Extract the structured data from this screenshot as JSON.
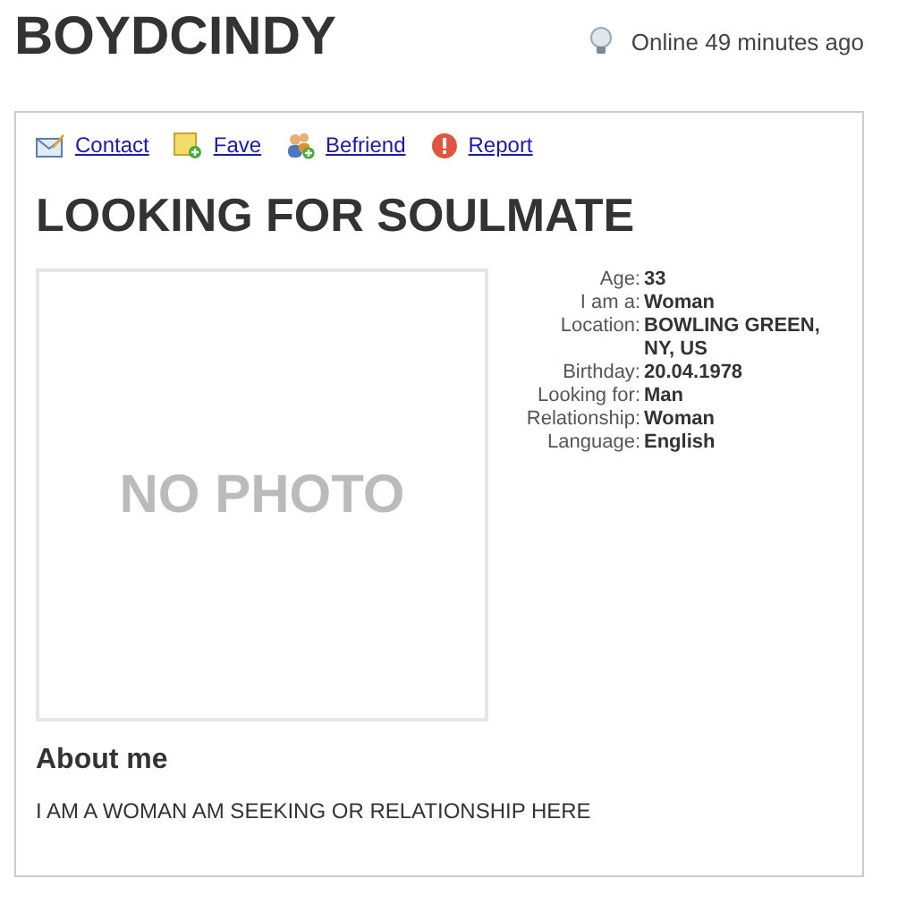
{
  "username": "BOYDCINDY",
  "status": "Online 49 minutes ago",
  "actions": [
    {
      "kind": "contact",
      "label": "Contact"
    },
    {
      "kind": "fave",
      "label": "Fave"
    },
    {
      "kind": "befriend",
      "label": "Befriend"
    },
    {
      "kind": "report",
      "label": "Report"
    }
  ],
  "headline": "LOOKING FOR SOULMATE",
  "photo_placeholder": "NO PHOTO",
  "details": [
    {
      "label": "Age:",
      "value": "33"
    },
    {
      "label": "I am a:",
      "value": "Woman"
    },
    {
      "label": "Location:",
      "value": "BOWLING GREEN, NY, US"
    },
    {
      "label": "Birthday:",
      "value": "20.04.1978"
    },
    {
      "label": "Looking for:",
      "value": "Man"
    },
    {
      "label": "Relationship:",
      "value": "Woman"
    },
    {
      "label": "Language:",
      "value": "English"
    }
  ],
  "about": {
    "heading": "About me",
    "text": "I AM A WOMAN AM SEEKING OR RELATIONSHIP HERE"
  }
}
